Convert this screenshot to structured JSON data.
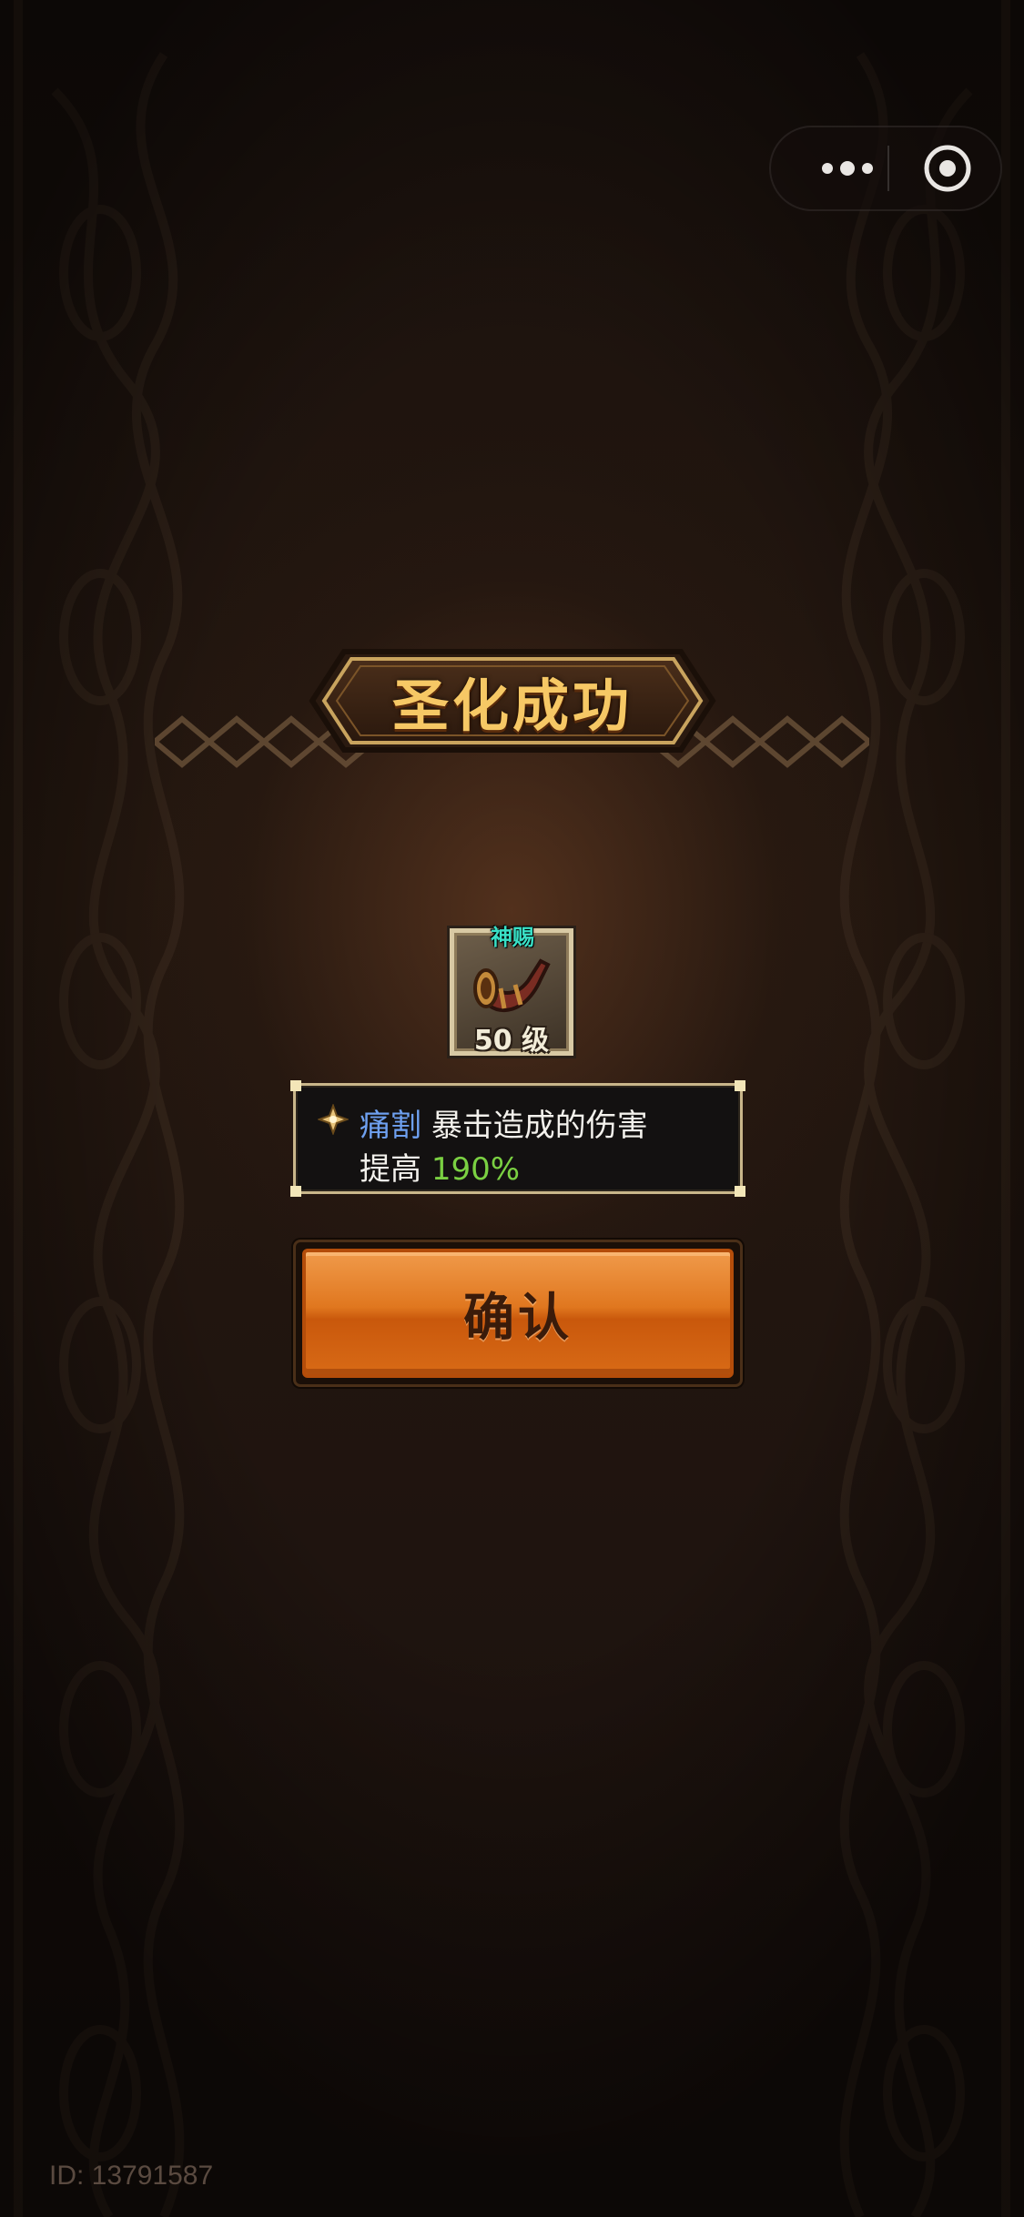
{
  "capsule": {
    "more_icon": "more-dots-icon",
    "close_icon": "target-circle-icon"
  },
  "title": "圣化成功",
  "item": {
    "tag": "神赐",
    "level": "50 级",
    "icon": "war-horn-icon"
  },
  "description": {
    "bullet_icon": "diamond-sparkle-icon",
    "skill_name": "痛割",
    "line1_text": "暴击造成的伤害",
    "line2_prefix": "提高",
    "value": "190%"
  },
  "confirm_label": "确认",
  "footer_id": "ID: 13791587",
  "colors": {
    "title_gold": "#f6c865",
    "skill_blue": "#6ea0f0",
    "value_green": "#7ad042",
    "button_orange": "#e0771f",
    "tag_teal": "#39e0c6"
  }
}
